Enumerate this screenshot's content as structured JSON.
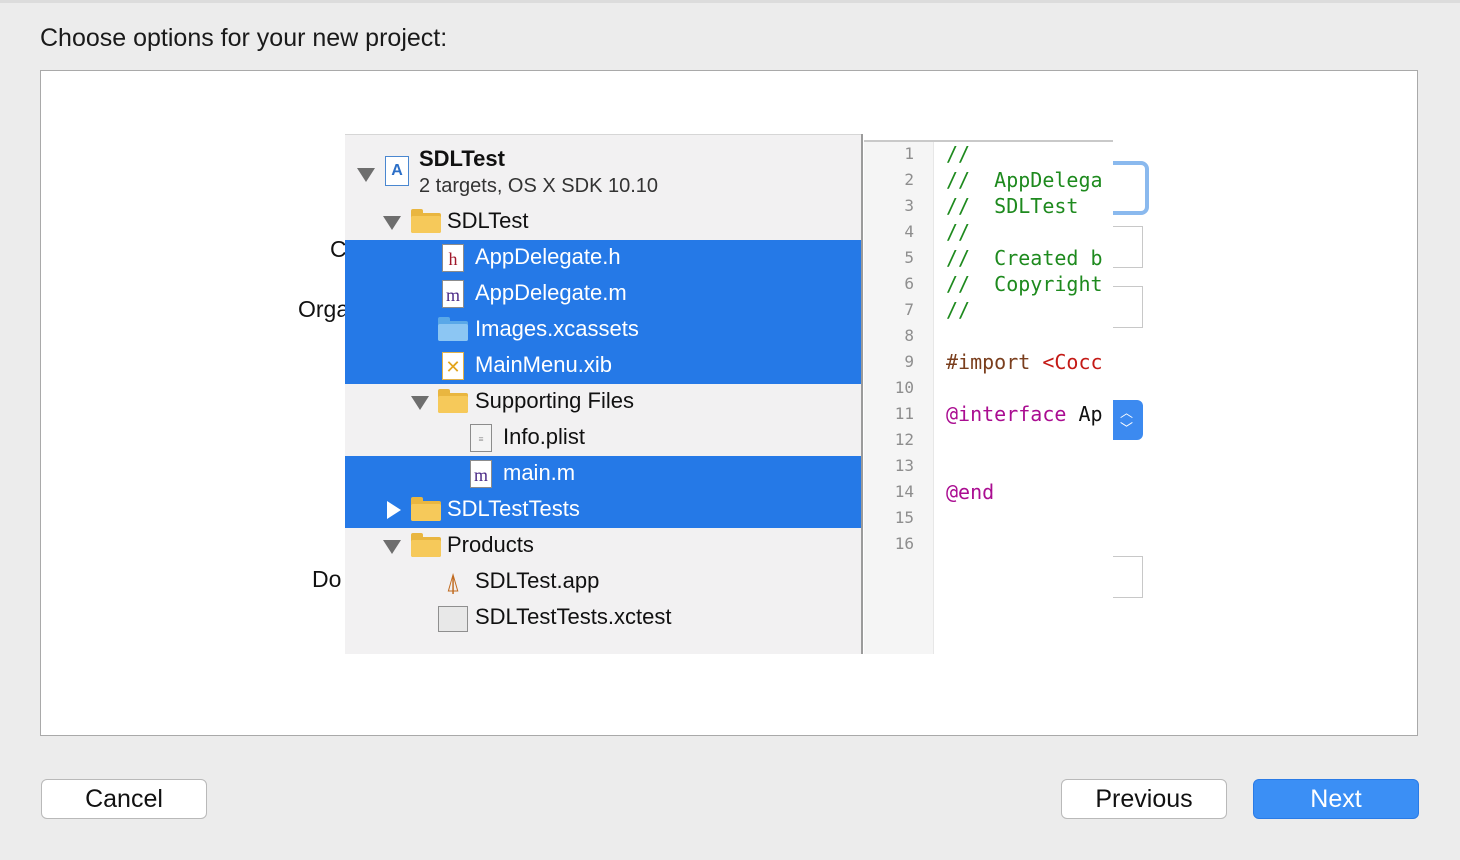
{
  "dialog": {
    "heading": "Choose options for your new project:"
  },
  "background_labels": {
    "product_name_fragment": "C",
    "organization_fragment": "Orga",
    "document_fragment": "Do"
  },
  "navigator": {
    "project": {
      "name": "SDLTest",
      "subtitle": "2 targets, OS X SDK 10.10"
    },
    "items": [
      {
        "label": "SDLTest",
        "icon": "folder-icon",
        "selected": false
      },
      {
        "label": "AppDelegate.h",
        "icon": "header-file-icon",
        "selected": true
      },
      {
        "label": "AppDelegate.m",
        "icon": "objc-file-icon",
        "selected": true
      },
      {
        "label": "Images.xcassets",
        "icon": "asset-catalog-icon",
        "selected": true
      },
      {
        "label": "MainMenu.xib",
        "icon": "xib-file-icon",
        "selected": true
      },
      {
        "label": "Supporting Files",
        "icon": "folder-icon",
        "selected": false
      },
      {
        "label": "Info.plist",
        "icon": "plist-file-icon",
        "selected": false
      },
      {
        "label": "main.m",
        "icon": "objc-file-icon",
        "selected": true
      },
      {
        "label": "SDLTestTests",
        "icon": "folder-icon",
        "selected": true
      },
      {
        "label": "Products",
        "icon": "folder-icon",
        "selected": false
      },
      {
        "label": "SDLTest.app",
        "icon": "app-icon",
        "selected": false
      },
      {
        "label": "SDLTestTests.xctest",
        "icon": "xctest-bundle-icon",
        "selected": false
      }
    ]
  },
  "editor": {
    "line_numbers": [
      "1",
      "2",
      "3",
      "4",
      "5",
      "6",
      "7",
      "8",
      "9",
      "10",
      "11",
      "12",
      "13",
      "14",
      "15",
      "16"
    ],
    "lines": {
      "l1": "//",
      "l2": "//  AppDelega",
      "l3": "//  SDLTest",
      "l4": "//",
      "l5": "//  Created b",
      "l6": "//  Copyright",
      "l7": "//",
      "l9_directive": "#import ",
      "l9_header": "<Cocc",
      "l11_keyword": "@interface",
      "l11_name": " Ap",
      "l14": "@end"
    }
  },
  "buttons": {
    "cancel": "Cancel",
    "previous": "Previous",
    "next": "Next"
  },
  "colors": {
    "selection": "#2579e7",
    "primary_button": "#3b8ff5",
    "comment": "#1e8a1e",
    "keyword": "#aa0d91"
  }
}
